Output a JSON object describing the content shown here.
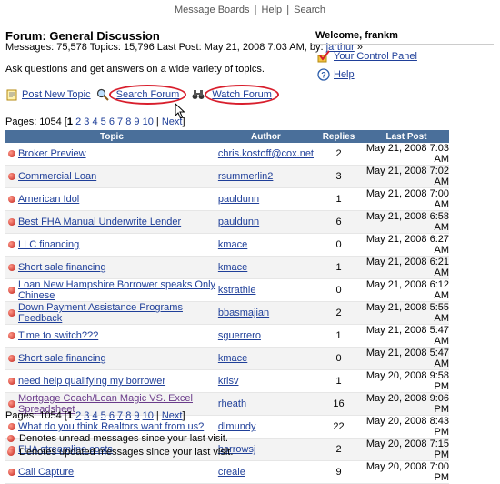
{
  "nav": {
    "message_boards": "Message Boards",
    "sep": "|",
    "help": "Help",
    "search": "Search"
  },
  "forum": {
    "title": "Forum: General Discussion",
    "stats_prefix": "Messages: 75,578  Topics: 15,796  Last Post: May 21, 2008 7:03 AM, by:",
    "last_poster": "jarthur",
    "stats_suffix": "»",
    "description": "Ask questions and get answers on a wide variety of topics."
  },
  "user": {
    "welcome": "Welcome, frankm",
    "control_panel": "Your Control Panel",
    "help": "Help"
  },
  "actions": {
    "post_new": "Post New Topic",
    "search_forum": "Search Forum",
    "watch_forum": "Watch Forum"
  },
  "pagination": {
    "label": "Pages: 1054 [",
    "current": "1",
    "pages": [
      "2",
      "3",
      "4",
      "5",
      "6",
      "7",
      "8",
      "9",
      "10"
    ],
    "close": "|",
    "next": "Next",
    "end": "]"
  },
  "table": {
    "headers": {
      "topic": "Topic",
      "author": "Author",
      "replies": "Replies",
      "last_post": "Last Post"
    },
    "rows": [
      {
        "topic": "Broker Preview",
        "author": "chris.kostoff@cox.net",
        "replies": "2",
        "last": "May 21, 2008 7:03 AM"
      },
      {
        "topic": "Commercial Loan",
        "author": "rsummerlin2",
        "replies": "3",
        "last": "May 21, 2008 7:02 AM"
      },
      {
        "topic": "American Idol",
        "author": "pauldunn",
        "replies": "1",
        "last": "May 21, 2008 7:00 AM"
      },
      {
        "topic": "Best FHA Manual Underwrite Lender",
        "author": "pauldunn",
        "replies": "6",
        "last": "May 21, 2008 6:58 AM"
      },
      {
        "topic": "LLC financing",
        "author": "kmace",
        "replies": "0",
        "last": "May 21, 2008 6:27 AM"
      },
      {
        "topic": "Short sale financing",
        "author": "kmace",
        "replies": "1",
        "last": "May 21, 2008 6:21 AM"
      },
      {
        "topic": "Loan New Hampshire Borrower speaks Only Chinese",
        "author": "kstrathie",
        "replies": "0",
        "last": "May 21, 2008 6:12 AM"
      },
      {
        "topic": "Down Payment Assistance Programs Feedback",
        "author": "bbasmajian",
        "replies": "2",
        "last": "May 21, 2008 5:55 AM"
      },
      {
        "topic": "Time to switch???",
        "author": "sguerrero",
        "replies": "1",
        "last": "May 21, 2008 5:47 AM"
      },
      {
        "topic": "Short sale financing",
        "author": "kmace",
        "replies": "0",
        "last": "May 21, 2008 5:47 AM"
      },
      {
        "topic": "need help qualifying my borrower",
        "author": "krisv",
        "replies": "1",
        "last": "May 20, 2008 9:58 PM"
      },
      {
        "topic": "Mortgage Coach/Loan Magic VS. Excel Spreadsheet",
        "author": "rheath",
        "replies": "16",
        "last": "May 20, 2008 9:06 PM"
      },
      {
        "topic": "What do you think Realtors want from us?",
        "author": "dlmundy",
        "replies": "22",
        "last": "May 20, 2008 8:43 PM"
      },
      {
        "topic": "FHA streamline costs",
        "author": "barrowsj",
        "replies": "2",
        "last": "May 20, 2008 7:15 PM"
      },
      {
        "topic": "Call Capture",
        "author": "creale",
        "replies": "9",
        "last": "May 20, 2008 7:00 PM"
      }
    ]
  },
  "legend": {
    "unread": "Denotes unread messages since your last visit.",
    "updated": "Denotes updated messages since your last visit."
  },
  "colors": {
    "highlight_circle": "#d81e2c",
    "header_bg": "#4a6f9a",
    "link": "#1f3f99"
  }
}
